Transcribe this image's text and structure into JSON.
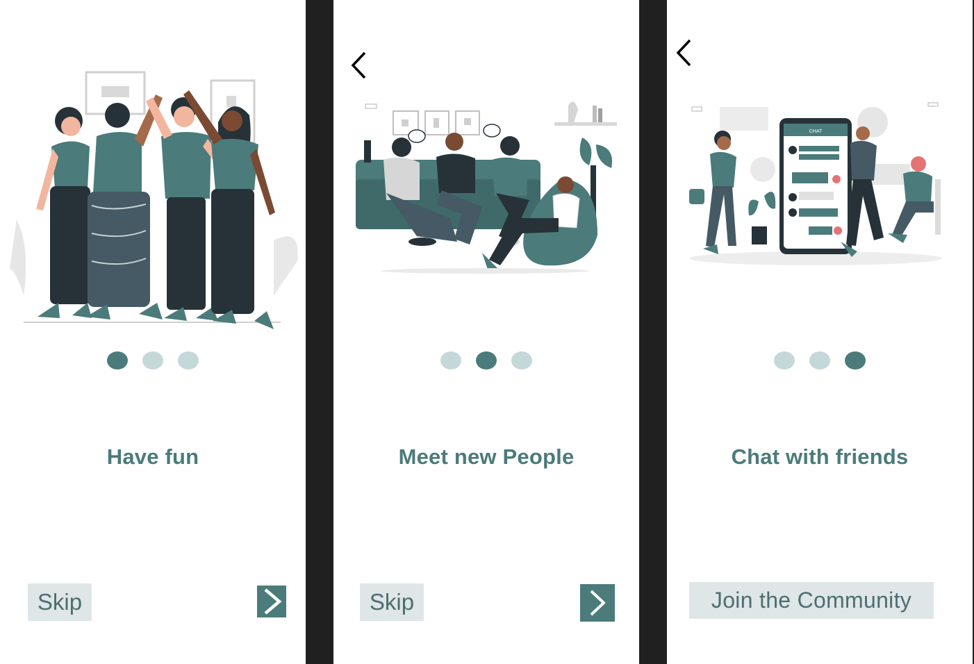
{
  "colors": {
    "accent": "#4b7b7a",
    "dot_active": "#4b7b7a",
    "dot_inactive": "#c4d8da",
    "button_bg": "#dfe6e7",
    "button_text": "#4e6e70",
    "dark": "#263238",
    "frame": "#202020"
  },
  "screens": [
    {
      "title": "Have fun",
      "illustration": "friends-high-five-illustration",
      "active_dot": 0,
      "skip_label": "Skip",
      "next_icon": "chevron-right-icon"
    },
    {
      "title": "Meet new People",
      "illustration": "party-on-couch-illustration",
      "active_dot": 1,
      "back_icon": "chevron-left-icon",
      "skip_label": "Skip",
      "next_icon": "chevron-right-icon"
    },
    {
      "title": "Chat with friends",
      "illustration": "phone-chat-illustration",
      "active_dot": 2,
      "back_icon": "chevron-left-icon",
      "join_label": "Join the Community"
    }
  ]
}
